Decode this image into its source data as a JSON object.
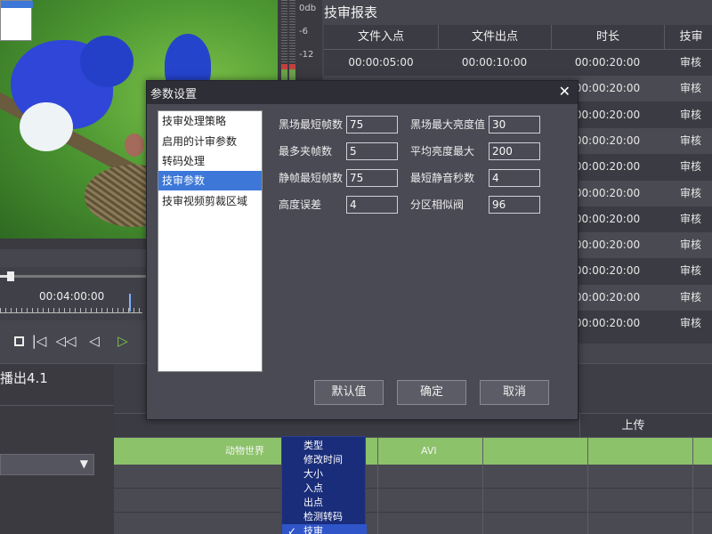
{
  "meter": {
    "labels": [
      "0db",
      "-6",
      "-12"
    ]
  },
  "player": {
    "timecode": "00:04:00:00",
    "buttons": {
      "stop": "stop-icon",
      "prev": "skip-start-icon",
      "rewind": "rewind-icon",
      "step_back": "step-back-icon",
      "play": "play-icon"
    }
  },
  "left_panel": {
    "title": "播出4.1",
    "select_arrow": "▼"
  },
  "report": {
    "title": "技审报表",
    "headers": [
      "文件入点",
      "文件出点",
      "时长",
      "技审"
    ],
    "rows": [
      [
        "00:00:05:00",
        "00:00:10:00",
        "00:00:20:00",
        "审核"
      ],
      [
        "",
        "",
        "00:00:20:00",
        "审核"
      ],
      [
        "",
        "",
        "00:00:20:00",
        "审核"
      ],
      [
        "",
        "",
        "00:00:20:00",
        "审核"
      ],
      [
        "",
        "",
        "00:00:20:00",
        "审核"
      ],
      [
        "",
        "",
        "00:00:20:00",
        "审核"
      ],
      [
        "",
        "",
        "00:00:20:00",
        "审核"
      ],
      [
        "",
        "",
        "00:00:20:00",
        "审核"
      ],
      [
        "",
        "",
        "00:00:20:00",
        "审核"
      ],
      [
        "",
        "",
        "00:00:20:00",
        "审核"
      ],
      [
        "",
        "",
        "00:00:20:00",
        "审核"
      ]
    ]
  },
  "bottom_table": {
    "header_upload": "上传",
    "green_row": {
      "name": "动物世界",
      "format": "AVI"
    }
  },
  "context_menu": {
    "items": [
      "类型",
      "修改时间",
      "大小",
      "入点",
      "出点",
      "检测转码",
      "技审"
    ],
    "checked_index": 6
  },
  "dialog": {
    "title": "参数设置",
    "close": "✕",
    "list": [
      "技审处理策略",
      "启用的计审参数",
      "转码处理",
      "技审参数",
      "技审视频剪裁区域"
    ],
    "selected_index": 3,
    "fields": {
      "black_min_frames": {
        "label": "黑场最短帧数",
        "value": "75"
      },
      "black_max_brightness": {
        "label": "黑场最大亮度值",
        "value": "30"
      },
      "max_flash_frames": {
        "label": "最多夹帧数",
        "value": "5"
      },
      "avg_brightness_max": {
        "label": "平均亮度最大",
        "value": "200"
      },
      "still_min_frames": {
        "label": "静帧最短帧数",
        "value": "75"
      },
      "min_silence_seconds": {
        "label": "最短静音秒数",
        "value": "4"
      },
      "height_error": {
        "label": "高度误差",
        "value": "4"
      },
      "zone_similarity": {
        "label": "分区相似阀",
        "value": "96"
      }
    },
    "buttons": {
      "default": "默认值",
      "ok": "确定",
      "cancel": "取消"
    }
  }
}
